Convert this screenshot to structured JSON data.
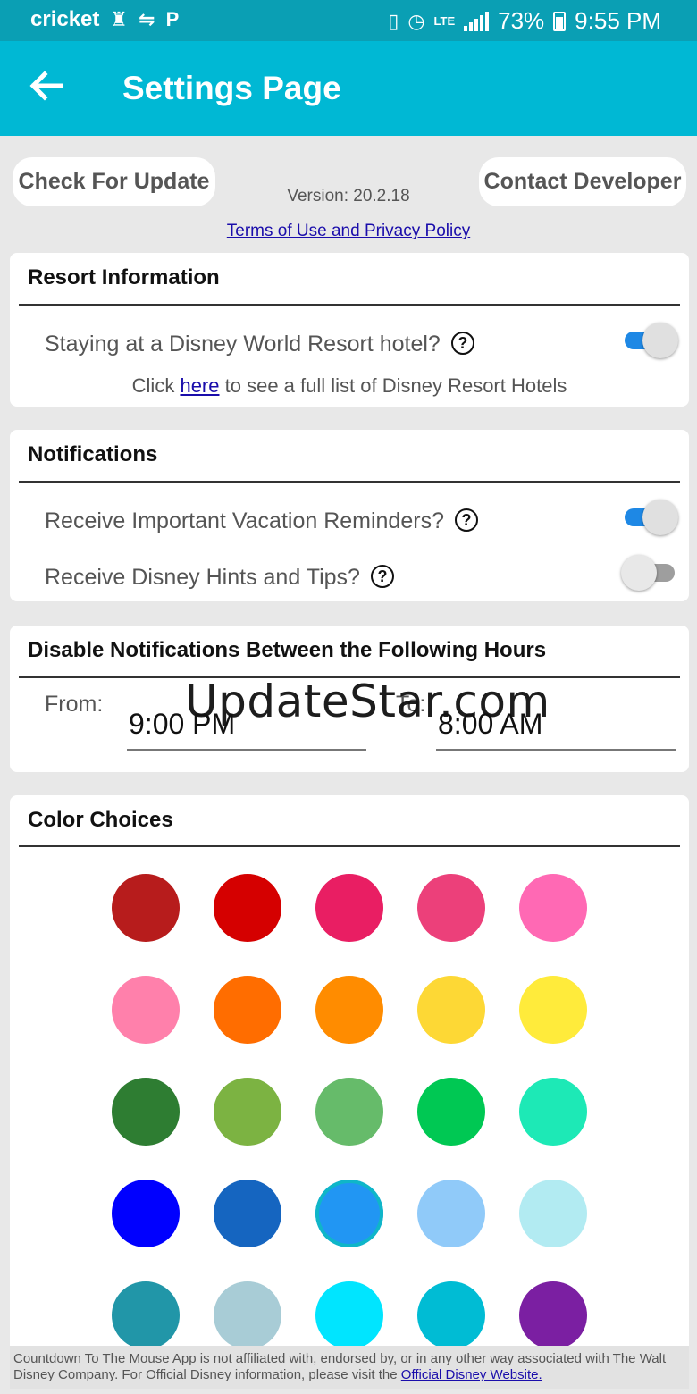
{
  "status_bar": {
    "carrier": "cricket",
    "network": "LTE",
    "battery": "73%",
    "time": "9:55 PM"
  },
  "app_bar": {
    "title": "Settings Page"
  },
  "top_actions": {
    "check_update": "Check For Update",
    "contact_developer": "Contact Developer",
    "version": "Version: 20.2.18",
    "terms_link": "Terms of Use and Privacy Policy"
  },
  "resort_info": {
    "title": "Resort Information",
    "staying_label": "Staying at a Disney World Resort hotel?",
    "staying_enabled": true,
    "click_prefix": "Click",
    "here_link": "here",
    "click_suffix": "to see a full list of Disney Resort Hotels"
  },
  "notifications": {
    "title": "Notifications",
    "reminders_label": "Receive Important Vacation Reminders?",
    "reminders_enabled": true,
    "hints_label": "Receive Disney Hints and Tips?",
    "hints_enabled": false
  },
  "quiet_hours": {
    "title": "Disable Notifications Between the Following Hours",
    "from_label": "From:",
    "from_value": "9:00 PM",
    "to_label": "To:",
    "to_value": "8:00 AM"
  },
  "watermark": "UpdateStar.com",
  "colors": {
    "title": "Color Choices",
    "selected_index": 17,
    "swatches": [
      "#b71c1c",
      "#d50000",
      "#e91e63",
      "#ec407a",
      "#ff69b4",
      "#ff80ab",
      "#ff6d00",
      "#ff8c00",
      "#fdd835",
      "#ffeb3b",
      "#2e7d32",
      "#7cb342",
      "#66bb6a",
      "#00c853",
      "#1de9b6",
      "#0000ff",
      "#1565c0",
      "#2196f3",
      "#90caf9",
      "#b2ebf2",
      "#2196a8",
      "#a8ccd6",
      "#00e5ff",
      "#00bcd4",
      "#7b1fa2"
    ]
  },
  "footer": {
    "disclaimer": "Countdown To The Mouse App is not affiliated with, endorsed by, or in any other way associated with The Walt Disney Company. For Official Disney information, please visit the",
    "link": "Official Disney Website."
  }
}
